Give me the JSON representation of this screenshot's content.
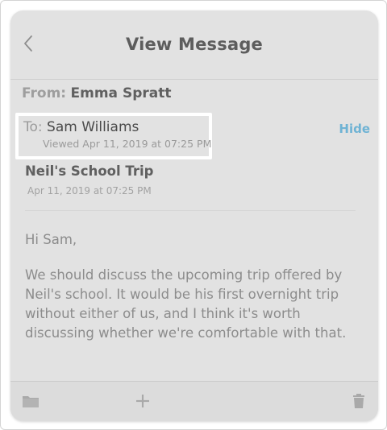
{
  "header": {
    "title": "View Message",
    "back_icon": "chevron-left-icon"
  },
  "message": {
    "from_label": "From:",
    "from_name": "Emma Spratt",
    "to_label": "To:",
    "to_name": "Sam Williams",
    "viewed": "Viewed Apr 11, 2019 at 07:25 PM",
    "hide_label": "Hide",
    "subject": "Neil's School Trip",
    "subject_date": "Apr 11, 2019 at 07:25 PM",
    "greeting": "Hi Sam,",
    "body": "We should discuss the upcoming trip offered by Neil's school. It would be his first overnight trip without either of us, and I think it's worth discussing whether we're comfortable with that."
  },
  "toolbar": {
    "icons": [
      "folder-icon",
      "plus-icon",
      "trash-icon"
    ]
  },
  "colors": {
    "background": "#e2e2e2",
    "accent_link": "#6fb3d4",
    "highlight_border": "#ffffff"
  }
}
